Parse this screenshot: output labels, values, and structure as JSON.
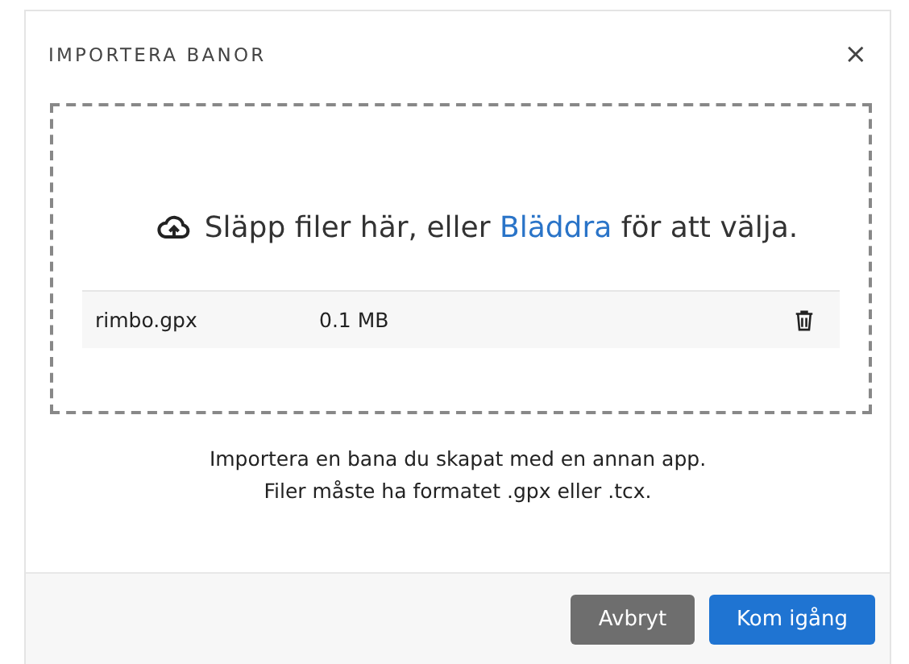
{
  "dialog": {
    "title": "IMPORTERA BANOR",
    "close": "×"
  },
  "dropzone": {
    "text_before": "Släpp filer här, eller ",
    "link": "Bläddra",
    "text_after": " för att välja."
  },
  "files": [
    {
      "name": "rimbo.gpx",
      "size": "0.1 MB"
    }
  ],
  "help": [
    "Importera en bana du skapat med en annan app.",
    "Filer måste ha formatet .gpx eller .tcx."
  ],
  "buttons": [
    {
      "label": "Avbryt",
      "kind": "secondary"
    },
    {
      "label": "Kom igång",
      "kind": "primary"
    }
  ]
}
